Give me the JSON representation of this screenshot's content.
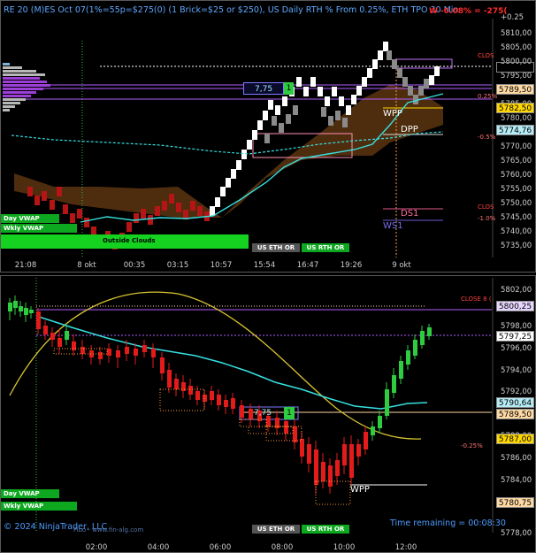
{
  "top_panel": {
    "header": "RE 20 (M)ES Oct 07(1%=55p=$275(0) (1 Brick=$25 or $250), US Daily RTH % From 0.25%, ETH TPO 30 Min",
    "header_right": "W -0.08% = -275(",
    "price_axis": [
      "+0.25",
      "5810,00",
      "5805,00",
      "5800,00",
      "5795,00",
      "5790,00",
      "5785,00",
      "5780,00",
      "5775,00",
      "5770,00",
      "5765,00",
      "5760,00",
      "5755,00",
      "5750,00",
      "5745,00",
      "5740,00",
      "5735,00"
    ],
    "price_boxes": [
      {
        "label": "5797,25",
        "bg": "#ffffff"
      },
      {
        "label": "5789,50",
        "bg": "#ffd9a3"
      },
      {
        "label": "5782,50",
        "bg": "#ffd700"
      },
      {
        "label": "5774,76",
        "bg": "#b6ecf5"
      }
    ],
    "time_axis": [
      "21:08",
      "8 okt",
      "00:35",
      "03:15",
      "10:57",
      "15:54",
      "16:47",
      "19:26",
      "9 okt"
    ],
    "annotations": {
      "clos1": "CLOS",
      "pct_025": "0.25%",
      "pct_05": "-0.5%",
      "clos2": "CLOS",
      "pct_1": "-1.0%",
      "wpp": "WPP",
      "dpp": "DPP",
      "ds1": "DS1",
      "ws1": "WS1",
      "val_box": "7,75",
      "val_box_badge": "1"
    },
    "tags": {
      "day_vwap": "Day VWAP",
      "wkly_vwap": "Wkly VWAP",
      "outside_clouds": "Outside Clouds",
      "us_eth_or": "US ETH OR",
      "us_rth_or": "US RTH OR"
    }
  },
  "bottom_panel": {
    "price_axis": [
      "5802,00",
      "5798,00",
      "5796,00",
      "5794,00",
      "5792,00",
      "5790,00",
      "5788,00",
      "5786,00",
      "5784,00",
      "5782,00",
      "5778,00"
    ],
    "price_boxes": [
      {
        "label": "5800,25",
        "bg": "#e8d7ff"
      },
      {
        "label": "5797,25",
        "bg": "#ffffff"
      },
      {
        "label": "5790,64",
        "bg": "#b6ecf5"
      },
      {
        "label": "5789,50",
        "bg": "#ffd9a3"
      },
      {
        "label": "5787,00",
        "bg": "#ffd700"
      },
      {
        "label": "5780,75",
        "bg": "#ffd9a3"
      }
    ],
    "time_axis": [
      "02:00",
      "04:00",
      "06:00",
      "08:00",
      "10:00",
      "12:00"
    ],
    "annotations": {
      "close": "CLOSE 8 (",
      "pct_025": "-0.25%",
      "wpp": "WPP",
      "val_box": "7,75",
      "val_box_badge": "1",
      "time_remaining": "Time remaining = 00:08:30"
    },
    "tags": {
      "day_vwap": "Day VWAP",
      "wkly_vwap": "Wkly VWAP",
      "us_eth_or": "US ETH OR",
      "us_rth_or": "US RTH OR"
    },
    "copyright": "© 2024 NinjaTrader, LLC",
    "watermark": "Fibo - www.fin-alg.com"
  },
  "colors": {
    "up_brick": "#ffffff",
    "down_brick": "#7f7f7f",
    "bear_candle": "#e31b1b",
    "bull_candle": "#2ecc40",
    "vwap": "#2ed3d3",
    "cloud": "#6b3d12",
    "profile": "#9b3fd6",
    "sine": "#d8c430"
  }
}
